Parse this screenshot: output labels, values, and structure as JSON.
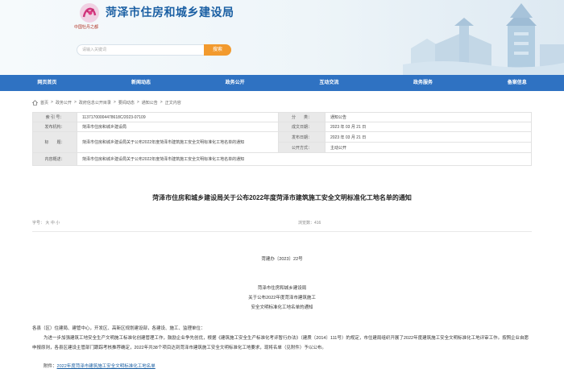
{
  "header": {
    "logo_subtitle": "中国牡丹之都",
    "site_title": "菏泽市住房和城乡建设局",
    "search_placeholder": "请输入关键词",
    "search_button": "搜索"
  },
  "nav": {
    "items": [
      "网页首页",
      "新闻动态",
      "政务公开",
      "互动交流",
      "政务服务",
      "备案信息"
    ]
  },
  "breadcrumb": {
    "items": [
      "首页",
      "政务公开",
      "政府信息公开目录",
      "要闻动态",
      "通知公告",
      "正文内容"
    ],
    "separator": ">"
  },
  "info_table": {
    "index_label": "索 引 号：",
    "index_value": "11371700004478618C/2023-07109",
    "category_label": "分　　类：",
    "category_value": "通知公告",
    "publisher_label": "发布机构：",
    "publisher_value": "菏泽市住房和城乡建设局",
    "created_label": "成文日期：",
    "created_value": "2023 年 03 月 21 日",
    "title_label": "标　　题：",
    "title_value": "菏泽市住房和城乡建设局关于公布2022年度菏泽市建筑施工安全文明标准化工地名单的通知",
    "published_label": "发布日期：",
    "published_value": "2023 年 03 月 21 日",
    "open_label": "公开方式：",
    "open_value": "主动公开",
    "summary_label": "内容概述：",
    "summary_value": "菏泽市住房和城乡建设局关于公布2022年度菏泽市建筑施工安全文明标准化工地名单的通知"
  },
  "article": {
    "title": "菏泽市住房和城乡建设局关于公布2022年度菏泽市建筑施工安全文明标准化工地名单的通知",
    "font_label": "字号：",
    "font_sizes": [
      "大",
      "中",
      "小"
    ],
    "views": "浏览数：416",
    "doc_no": "菏建办〔2023〕22号",
    "center_lines": [
      "菏泽市住房和城乡建设局",
      "关于公布2022年度菏泽市建筑施工",
      "安全文明标准化工地名单的通知"
    ],
    "salutation": "各县（区）住建局、建管中心，开发区、高新区规划建设部，各建设、施工、监理单位：",
    "body": "为进一步加强建筑工地安全生产文明施工标准化创建管理工作，鼓励企业争先创优，根据《建筑施工安全生产标准化考评暂行办法》（建质〔2014〕111号）的规定，市住建局组织开展了2022年度建筑施工安全文明标准化工地评审工作。按照企业自愿申报原则，各县区建设主管部门跟踪考核推荐确定，2022年共38个项目达到菏泽市建筑施工安全文明标准化工地要求，现将名单（见附件）予以公布。",
    "attachment_label": "附件：",
    "attachment_link": "2022年度菏泽市建筑施工安全文明标准化工地名单"
  },
  "colors": {
    "title_blue": "#1a5fa3",
    "nav_blue": "#2f72c2",
    "search_orange": "#f29a2e"
  }
}
